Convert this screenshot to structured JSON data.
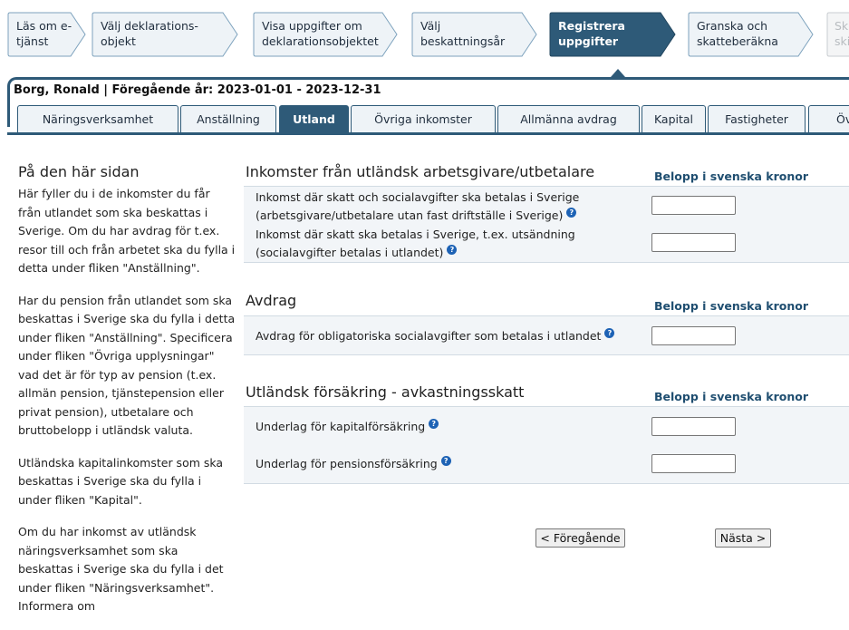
{
  "wizard": {
    "steps": [
      {
        "label": "Läs om e-tjänst",
        "l1": "Läs om e-",
        "l2": "tjänst"
      },
      {
        "label": "Välj deklarations-objekt",
        "l1": "Välj deklarations-",
        "l2": "objekt"
      },
      {
        "label": "Visa uppgifter om deklarationsobjektet",
        "l1": "Visa uppgifter om",
        "l2": "deklarationsobjektet"
      },
      {
        "label": "Välj beskattningsår",
        "l1": "Välj",
        "l2": "beskattningsår"
      },
      {
        "label": "Registrera uppgifter",
        "l1": "Registrera",
        "l2": "uppgifter"
      },
      {
        "label": "Granska och skatteberäkna",
        "l1": "Granska och",
        "l2": "skatteberäkna"
      },
      {
        "label": "Skicka in",
        "l1": "Sk",
        "l2": "ski"
      }
    ],
    "active_index": 4
  },
  "header": {
    "title": "Borg, Ronald | Föregående år: 2023-01-01 - 2023-12-31"
  },
  "tabs": [
    {
      "label": "Näringsverksamhet"
    },
    {
      "label": "Anställning"
    },
    {
      "label": "Utland"
    },
    {
      "label": "Övriga inkomster"
    },
    {
      "label": "Allmänna avdrag"
    },
    {
      "label": "Kapital"
    },
    {
      "label": "Fastigheter"
    },
    {
      "label": "Öv"
    }
  ],
  "sidebar": {
    "heading": "På den här sidan",
    "paragraphs": [
      "Här fyller du i de inkomster du får från utlandet som ska beskattas i Sverige. Om du har avdrag för t.ex. resor till och från arbetet ska du fylla i detta under fliken \"Anställning\".",
      "Har du pension från utlandet som ska beskattas i Sverige ska du fylla i detta under fliken \"Anställning\". Specificera under fliken \"Övriga upplysningar\" vad det är för typ av pension (t.ex. allmän pension, tjänstepension eller privat pension), utbetalare och bruttobelopp i utländsk valuta.",
      "Utländska kapitalinkomster som ska beskattas i Sverige ska du fylla i under fliken \"Kapital\".",
      "Om du har inkomst av utländsk näringsverksamhet som ska beskattas i Sverige ska du fylla i det under fliken \"Näringsverksamhet\". Informera om"
    ]
  },
  "sections": [
    {
      "title": "Inkomster från utländsk arbetsgivare/utbetalare",
      "column_header": "Belopp i svenska kronor",
      "rows": [
        {
          "line1": "Inkomst där skatt och socialavgifter ska betalas i Sverige",
          "line2": "(arbetsgivare/utbetalare utan fast driftställe i Sverige)",
          "value": ""
        },
        {
          "line1": "Inkomst där skatt ska betalas i Sverige, t.ex. utsändning",
          "line2": "(socialavgifter betalas i utlandet)",
          "value": ""
        }
      ]
    },
    {
      "title": "Avdrag",
      "column_header": "Belopp i svenska kronor",
      "rows": [
        {
          "line1": "Avdrag för obligatoriska socialavgifter som betalas i utlandet",
          "value": ""
        }
      ]
    },
    {
      "title": "Utländsk försäkring - avkastningsskatt",
      "column_header": "Belopp i svenska kronor",
      "rows": [
        {
          "line1": "Underlag för kapitalförsäkring",
          "value": ""
        },
        {
          "line1": "Underlag för pensionsförsäkring",
          "value": ""
        }
      ]
    }
  ],
  "help_icon": "?",
  "icons": {
    "help": "help-circle-icon"
  },
  "nav": {
    "prev_label": "< Föregående",
    "next_label": "Nästa >"
  },
  "colors": {
    "accent": "#2e5a78",
    "step_bg": "#eef3f7",
    "help": "#1d62b5",
    "column_header": "#1f4e70"
  }
}
